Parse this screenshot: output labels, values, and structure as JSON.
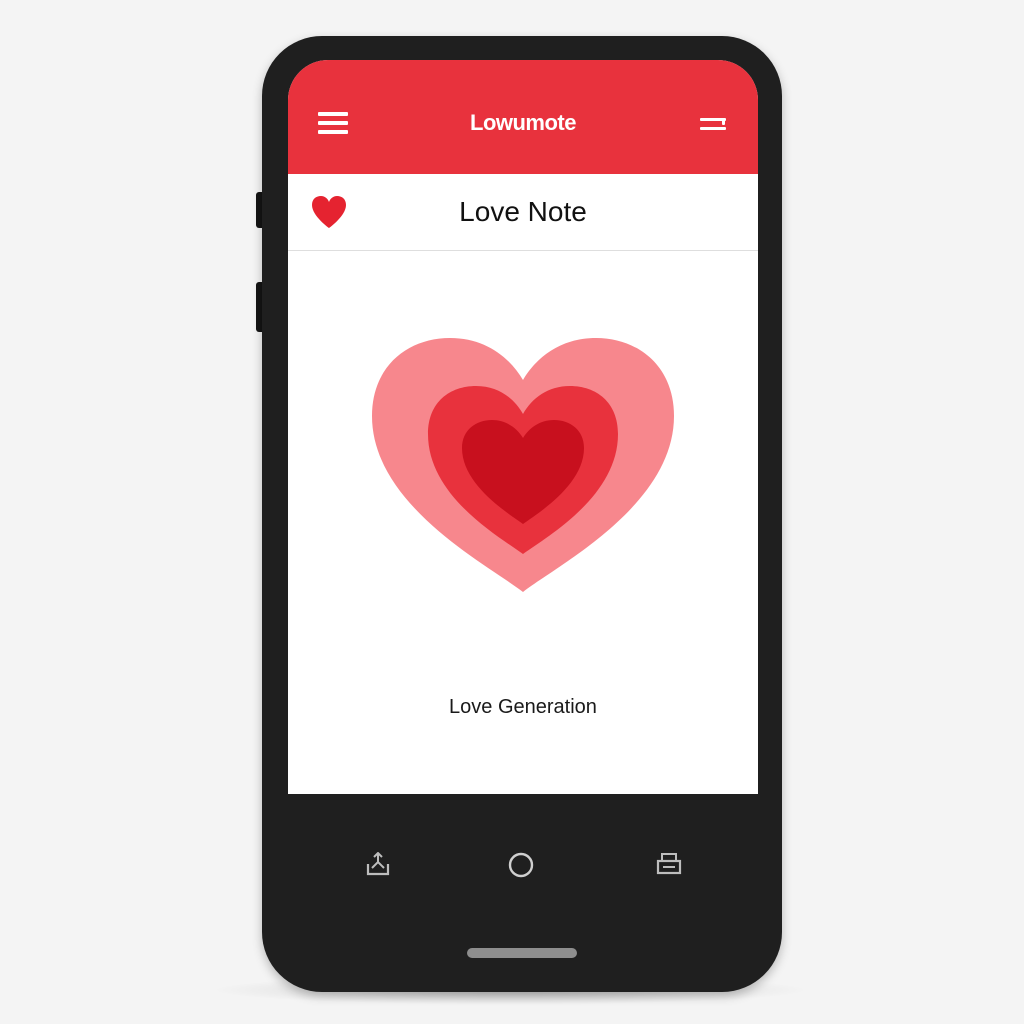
{
  "app_bar": {
    "title": "Lowumote",
    "color": "#e8323d",
    "menu_icon": "hamburger-menu-icon",
    "more_icon": "more-lines-icon"
  },
  "header": {
    "title": "Love Note",
    "icon": "heart-icon",
    "icon_color": "#e52330"
  },
  "main": {
    "illustration": "layered-heart-icon",
    "heart_colors": [
      "#f7878d",
      "#e8323d",
      "#c8101e"
    ],
    "caption": "Love Generation"
  },
  "nav_bar": {
    "left_icon": "share-tray-icon",
    "center_icon": "home-circle-icon",
    "right_icon": "printer-icon"
  },
  "colors": {
    "phone_body": "#1f1f1f",
    "screen_bg": "#ffffff",
    "accent": "#e8323d"
  }
}
